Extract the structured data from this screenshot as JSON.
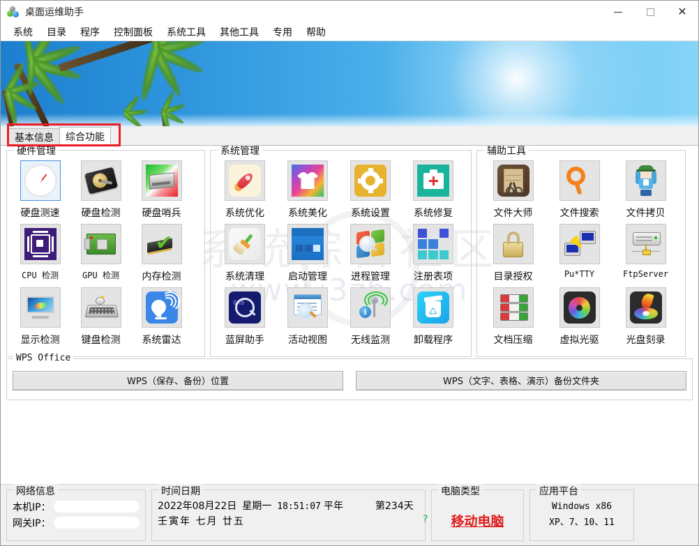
{
  "window": {
    "title": "桌面运维助手",
    "icon": "app-balls-icon",
    "controls": {
      "minimize": "—",
      "maximize": "▢",
      "close": "✕"
    }
  },
  "menubar": {
    "items": [
      {
        "label": "系统"
      },
      {
        "label": "目录"
      },
      {
        "label": "程序"
      },
      {
        "label": "控制面板"
      },
      {
        "label": "系统工具"
      },
      {
        "label": "其他工具"
      },
      {
        "label": "专用"
      },
      {
        "label": "帮助"
      }
    ]
  },
  "banner": {
    "alt": "tropical-palm-banner"
  },
  "tabs": {
    "items": [
      {
        "label": "基本信息",
        "active": false
      },
      {
        "label": "综合功能",
        "active": true
      }
    ],
    "highlight_color": "#ed1c24"
  },
  "watermark": {
    "cn": "系统综合社区",
    "url": "www.i3zh.com"
  },
  "groups": [
    {
      "title": "硬件管理",
      "tiles": [
        {
          "label": "硬盘测速",
          "icon": "disk-speed-gauge-icon",
          "selected": true
        },
        {
          "label": "硬盘检测",
          "icon": "hard-disk-icon",
          "selected": false
        },
        {
          "label": "硬盘哨兵",
          "icon": "disk-sentinel-icon",
          "selected": false
        },
        {
          "label": "CPU 检测",
          "icon": "cpu-chip-icon",
          "selected": false,
          "mono": true
        },
        {
          "label": "GPU 检测",
          "icon": "gpu-card-icon",
          "selected": false,
          "mono": true
        },
        {
          "label": "内存检测",
          "icon": "memory-check-icon",
          "selected": false
        },
        {
          "label": "显示检测",
          "icon": "monitor-icon",
          "selected": false
        },
        {
          "label": "键盘检测",
          "icon": "keyboard-icon",
          "selected": false
        },
        {
          "label": "系统雷达",
          "icon": "radar-dish-icon",
          "selected": false
        }
      ]
    },
    {
      "title": "系统管理",
      "tiles": [
        {
          "label": "系统优化",
          "icon": "rocket-icon",
          "selected": false
        },
        {
          "label": "系统美化",
          "icon": "tshirt-icon",
          "selected": false
        },
        {
          "label": "系统设置",
          "icon": "gear-icon",
          "selected": false
        },
        {
          "label": "系统修复",
          "icon": "medkit-icon",
          "selected": false
        },
        {
          "label": "系统清理",
          "icon": "broom-icon",
          "selected": false
        },
        {
          "label": "启动管理",
          "icon": "startup-window-icon",
          "selected": false
        },
        {
          "label": "进程管理",
          "icon": "process-magnifier-icon",
          "selected": false
        },
        {
          "label": "注册表项",
          "icon": "registry-grid-icon",
          "selected": false
        },
        {
          "label": "蓝屏助手",
          "icon": "bluescreen-magnifier-icon",
          "selected": false
        },
        {
          "label": "活动视图",
          "icon": "activity-view-icon",
          "selected": false
        },
        {
          "label": "无线监测",
          "icon": "wireless-signal-icon",
          "selected": false
        },
        {
          "label": "卸载程序",
          "icon": "uninstall-bin-icon",
          "selected": false
        }
      ]
    },
    {
      "title": "辅助工具",
      "tiles": [
        {
          "label": "文件大师",
          "icon": "file-master-scissors-icon",
          "selected": false
        },
        {
          "label": "文件搜索",
          "icon": "search-magnifier-icon",
          "selected": false
        },
        {
          "label": "文件拷贝",
          "icon": "anime-girl-copy-icon",
          "selected": false
        },
        {
          "label": "目录授权",
          "icon": "padlock-icon",
          "selected": false
        },
        {
          "label": "Pu*TTY",
          "icon": "putty-terminal-icon",
          "selected": false,
          "mono": true
        },
        {
          "label": "FtpServer",
          "icon": "ftp-server-icon",
          "selected": false,
          "mono": true
        },
        {
          "label": "文档压缩",
          "icon": "winrar-books-icon",
          "selected": false
        },
        {
          "label": "虚拟光驱",
          "icon": "virtual-disc-icon",
          "selected": false
        },
        {
          "label": "光盘刻录",
          "icon": "disc-burn-flame-icon",
          "selected": false
        }
      ]
    }
  ],
  "wps": {
    "title": "WPS Office",
    "buttons": [
      {
        "label": "WPS（保存、备份）位置"
      },
      {
        "label": "WPS（文字、表格、演示）备份文件夹"
      }
    ]
  },
  "status": {
    "network": {
      "title": "网络信息",
      "local_ip_label": "本机IP：",
      "local_ip_value": "",
      "gateway_ip_label": "网关IP：",
      "gateway_ip_value": ""
    },
    "datetime": {
      "title": "时间日期",
      "date": "2022年08月22日",
      "weekday": "星期一",
      "clock": "18:51:07",
      "year_type": "平年",
      "day_of_year": "第234天",
      "help": "?",
      "lunar": "壬寅年  七月  廿五"
    },
    "pc_type": {
      "title": "电脑类型",
      "value": "移动电脑",
      "color": "#e01b1b"
    },
    "platform": {
      "title": "应用平台",
      "line1": "Windows x86",
      "line2": "XP、7、10、11"
    }
  }
}
